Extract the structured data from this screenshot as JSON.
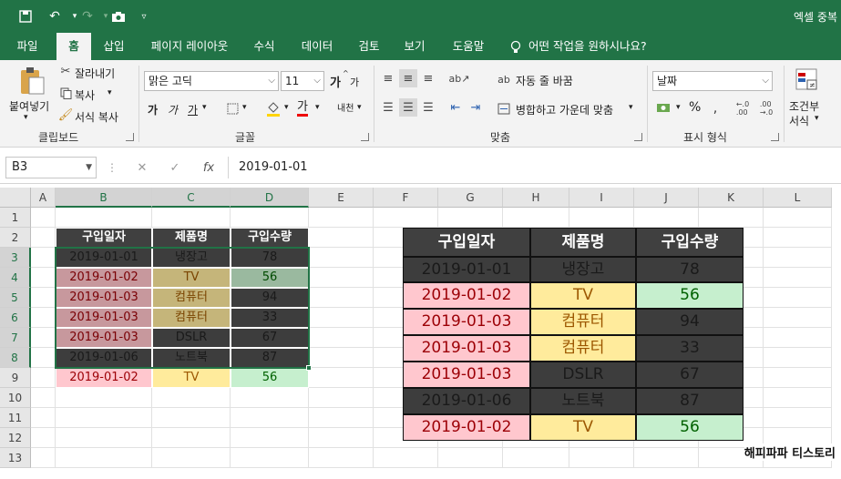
{
  "titlebar": {
    "title": "엑셀 중복",
    "accent": "#217346"
  },
  "tabs": [
    {
      "label": "파일"
    },
    {
      "label": "홈"
    },
    {
      "label": "삽입"
    },
    {
      "label": "페이지 레이아웃"
    },
    {
      "label": "수식"
    },
    {
      "label": "데이터"
    },
    {
      "label": "검토"
    },
    {
      "label": "보기"
    },
    {
      "label": "도움말"
    },
    {
      "label": "어떤 작업을 원하시나요?"
    }
  ],
  "ribbon": {
    "clipboard": {
      "paste": "붙여넣기",
      "cut": "잘라내기",
      "copy": "복사",
      "format_painter": "서식 복사",
      "label": "클립보드"
    },
    "font": {
      "name": "맑은 고딕",
      "size": "11",
      "grow": "가",
      "shrink": "가",
      "bold": "가",
      "italic": "가",
      "underline": "가",
      "font_color": "가",
      "phonetic": "내천",
      "label": "글꼴"
    },
    "alignment": {
      "wrap": "자동 줄 바꿈",
      "merge": "병합하고 가운데 맞춤",
      "label": "맞춤"
    },
    "number": {
      "format": "날짜",
      "percent": "%",
      "label": "표시 형식"
    },
    "styles": {
      "conditional_1": "조건부",
      "conditional_2": "서식"
    }
  },
  "formula_bar": {
    "name_box": "B3",
    "fx": "fx",
    "value": "2019-01-01"
  },
  "grid": {
    "columns": [
      "A",
      "B",
      "C",
      "D",
      "E",
      "F",
      "G",
      "H",
      "I",
      "J",
      "K",
      "L"
    ],
    "rows": [
      "1",
      "2",
      "3",
      "4",
      "5",
      "6",
      "7",
      "8",
      "9",
      "10",
      "11",
      "12",
      "13"
    ]
  },
  "table_small": {
    "headers": [
      "구입일자",
      "제품명",
      "구입수량"
    ],
    "rows": [
      [
        "2019-01-01",
        "냉장고",
        "78"
      ],
      [
        "2019-01-02",
        "TV",
        "56"
      ],
      [
        "2019-01-03",
        "컴퓨터",
        "94"
      ],
      [
        "2019-01-03",
        "컴퓨터",
        "33"
      ],
      [
        "2019-01-03",
        "DSLR",
        "67"
      ],
      [
        "2019-01-06",
        "노트북",
        "87"
      ],
      [
        "2019-01-02",
        "TV",
        "56"
      ]
    ]
  },
  "table_big": {
    "headers": [
      "구입일자",
      "제품명",
      "구입수량"
    ],
    "rows": [
      [
        "2019-01-01",
        "냉장고",
        "78"
      ],
      [
        "2019-01-02",
        "TV",
        "56"
      ],
      [
        "2019-01-03",
        "컴퓨터",
        "94"
      ],
      [
        "2019-01-03",
        "컴퓨터",
        "33"
      ],
      [
        "2019-01-03",
        "DSLR",
        "67"
      ],
      [
        "2019-01-06",
        "노트북",
        "87"
      ],
      [
        "2019-01-02",
        "TV",
        "56"
      ]
    ]
  },
  "highlight_colors": {
    "duplicate_date_fill": "#ffc7ce",
    "duplicate_product_fill": "#ffeb9c",
    "duplicate_qty_fill": "#c6efce",
    "header_fill": "#404040"
  },
  "watermark": "해피파파 티스토리"
}
